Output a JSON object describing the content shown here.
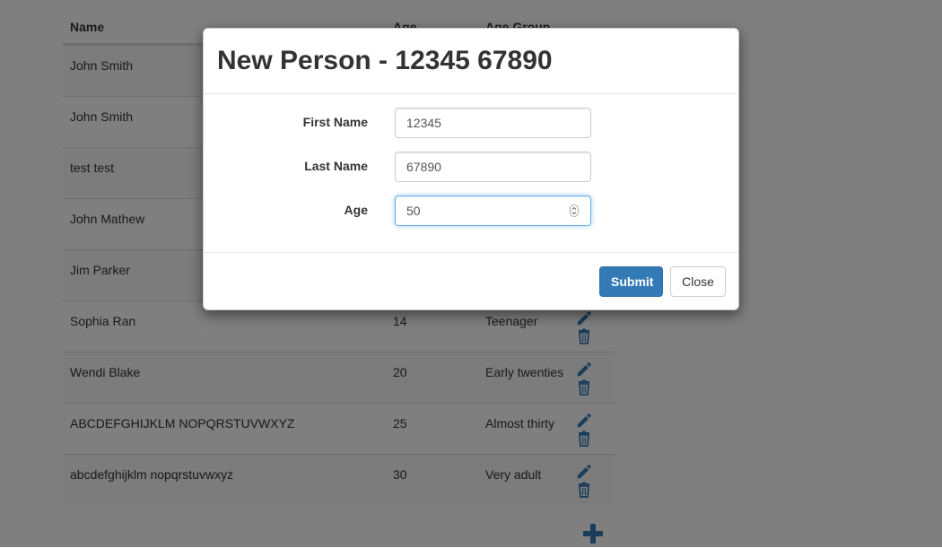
{
  "table": {
    "headers": {
      "name": "Name",
      "age": "Age",
      "age_group": "Age Group"
    },
    "rows": [
      {
        "name": "John Smith",
        "age": "",
        "group": ""
      },
      {
        "name": "John Smith",
        "age": "",
        "group": ""
      },
      {
        "name": "test test",
        "age": "",
        "group": ""
      },
      {
        "name": "John Mathew",
        "age": "",
        "group": ""
      },
      {
        "name": "Jim Parker",
        "age": "",
        "group": ""
      },
      {
        "name": "Sophia Ran",
        "age": "14",
        "group": "Teenager"
      },
      {
        "name": "Wendi Blake",
        "age": "20",
        "group": "Early twenties"
      },
      {
        "name": "ABCDEFGHIJKLM NOPQRSTUVWXYZ",
        "age": "25",
        "group": "Almost thirty"
      },
      {
        "name": "abcdefghijklm nopqrstuvwxyz",
        "age": "30",
        "group": "Very adult"
      }
    ],
    "row_icons": [
      "pencil-icon",
      "trash-icon"
    ],
    "add_icon": "plus-icon"
  },
  "modal": {
    "title": "New Person - 12345 67890",
    "fields": [
      {
        "label": "First Name",
        "value": "12345"
      },
      {
        "label": "Last Name",
        "value": "67890"
      },
      {
        "label": "Age",
        "value": "50"
      }
    ],
    "submit_label": "Submit",
    "close_label": "Close"
  },
  "colors": {
    "primary": "#337ab7",
    "icon": "#337ab7",
    "focus_border": "#66afe9"
  }
}
